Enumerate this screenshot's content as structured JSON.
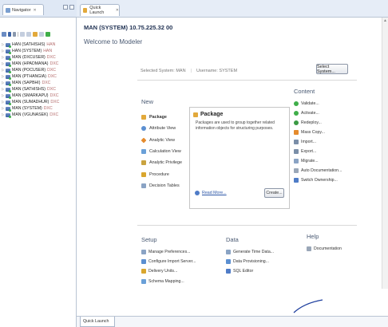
{
  "navigator": {
    "tab_label": "Navigator",
    "systems": [
      {
        "user": "HAN (SATHISHS)",
        "host": "HAN"
      },
      {
        "user": "HAN (SYSTEM)",
        "host": "HAN"
      },
      {
        "user": "MAN (DXCUSER)",
        "host": "DXC"
      },
      {
        "user": "MAN (HPADMANA)",
        "host": "DXC"
      },
      {
        "user": "MAN (POCUSER)",
        "host": "DXC"
      },
      {
        "user": "MAN (PTHANGIA)",
        "host": "DXC"
      },
      {
        "user": "MAN (SAPBHI)",
        "host": "DXC"
      },
      {
        "user": "MAN (SATHISHS)",
        "host": "DXC"
      },
      {
        "user": "MAN (SMARKAPU)",
        "host": "DXC"
      },
      {
        "user": "MAN (SUMADHUR)",
        "host": "DXC"
      },
      {
        "user": "MAN (SYSTEM)",
        "host": "DXC"
      },
      {
        "user": "MAN (VGUNASEK)",
        "host": "DXC"
      }
    ]
  },
  "editor": {
    "tab_label": "Quick Launch",
    "connection": "MAN (SYSTEM) 10.75.225.32 00",
    "page_title": "Welcome to Modeler",
    "selected_system_label": "Selected System: MAN",
    "username_label": "Username: SYSTEM",
    "select_system_button": "Select System..."
  },
  "new_section": {
    "title": "New",
    "items": [
      {
        "label": "Package",
        "icon": "package-icon",
        "color": "#e2a93b"
      },
      {
        "label": "Attribute View",
        "icon": "attribute-view-icon",
        "color": "#5b8fd1"
      },
      {
        "label": "Analytic View",
        "icon": "analytic-view-icon",
        "color": "#e58b2d"
      },
      {
        "label": "Calculation View",
        "icon": "calculation-view-icon",
        "color": "#6aa0d8"
      },
      {
        "label": "Analytic Privilege",
        "icon": "analytic-privilege-icon",
        "color": "#c9a340"
      },
      {
        "label": "Procedure",
        "icon": "procedure-icon",
        "color": "#d9a62e"
      },
      {
        "label": "Decision Tables",
        "icon": "decision-tables-icon",
        "color": "#8aa3c4"
      }
    ],
    "detail": {
      "title": "Package",
      "description": "Packages are used to group together related information objects for structuring purposes.",
      "read_more": "Read More...",
      "create_button": "Create..."
    }
  },
  "content_section": {
    "title": "Content",
    "items": [
      {
        "label": "Validate...",
        "icon": "validate-icon",
        "color": "#3fae49"
      },
      {
        "label": "Activate...",
        "icon": "activate-icon",
        "color": "#3fae49"
      },
      {
        "label": "Redeploy...",
        "icon": "redeploy-icon",
        "color": "#3a9a44"
      },
      {
        "label": "Mass Copy...",
        "icon": "mass-copy-icon",
        "color": "#e58b2d"
      },
      {
        "label": "Import...",
        "icon": "import-icon",
        "color": "#7a8ea8"
      },
      {
        "label": "Export...",
        "icon": "export-icon",
        "color": "#7a8ea8"
      },
      {
        "label": "Migrate...",
        "icon": "migrate-icon",
        "color": "#8aa3c4"
      },
      {
        "label": "Auto Documentation...",
        "icon": "auto-documentation-icon",
        "color": "#9aa7b8"
      },
      {
        "label": "Switch Ownership...",
        "icon": "switch-ownership-icon",
        "color": "#4f7cc7"
      }
    ]
  },
  "setup_section": {
    "title": "Setup",
    "items": [
      {
        "label": "Manage Preferences...",
        "icon": "preferences-icon",
        "color": "#8aa3c4"
      },
      {
        "label": "Configure Import Server...",
        "icon": "configure-import-server-icon",
        "color": "#5b8fd1"
      },
      {
        "label": "Delivery Units...",
        "icon": "delivery-units-icon",
        "color": "#d9a62e"
      },
      {
        "label": "Schema Mapping...",
        "icon": "schema-mapping-icon",
        "color": "#6aa0d8"
      }
    ]
  },
  "data_section": {
    "title": "Data",
    "items": [
      {
        "label": "Generate Time Data...",
        "icon": "time-data-icon",
        "color": "#8aa3c4"
      },
      {
        "label": "Data Provisioning...",
        "icon": "data-provisioning-icon",
        "color": "#5b8fd1"
      },
      {
        "label": "SQL Editor",
        "icon": "sql-editor-icon",
        "color": "#4f7cc7"
      }
    ]
  },
  "help_section": {
    "title": "Help",
    "items": [
      {
        "label": "Documentation",
        "icon": "documentation-icon",
        "color": "#9aa7b8"
      }
    ]
  },
  "footer": {
    "quick_launch_label": "Quick Launch"
  }
}
